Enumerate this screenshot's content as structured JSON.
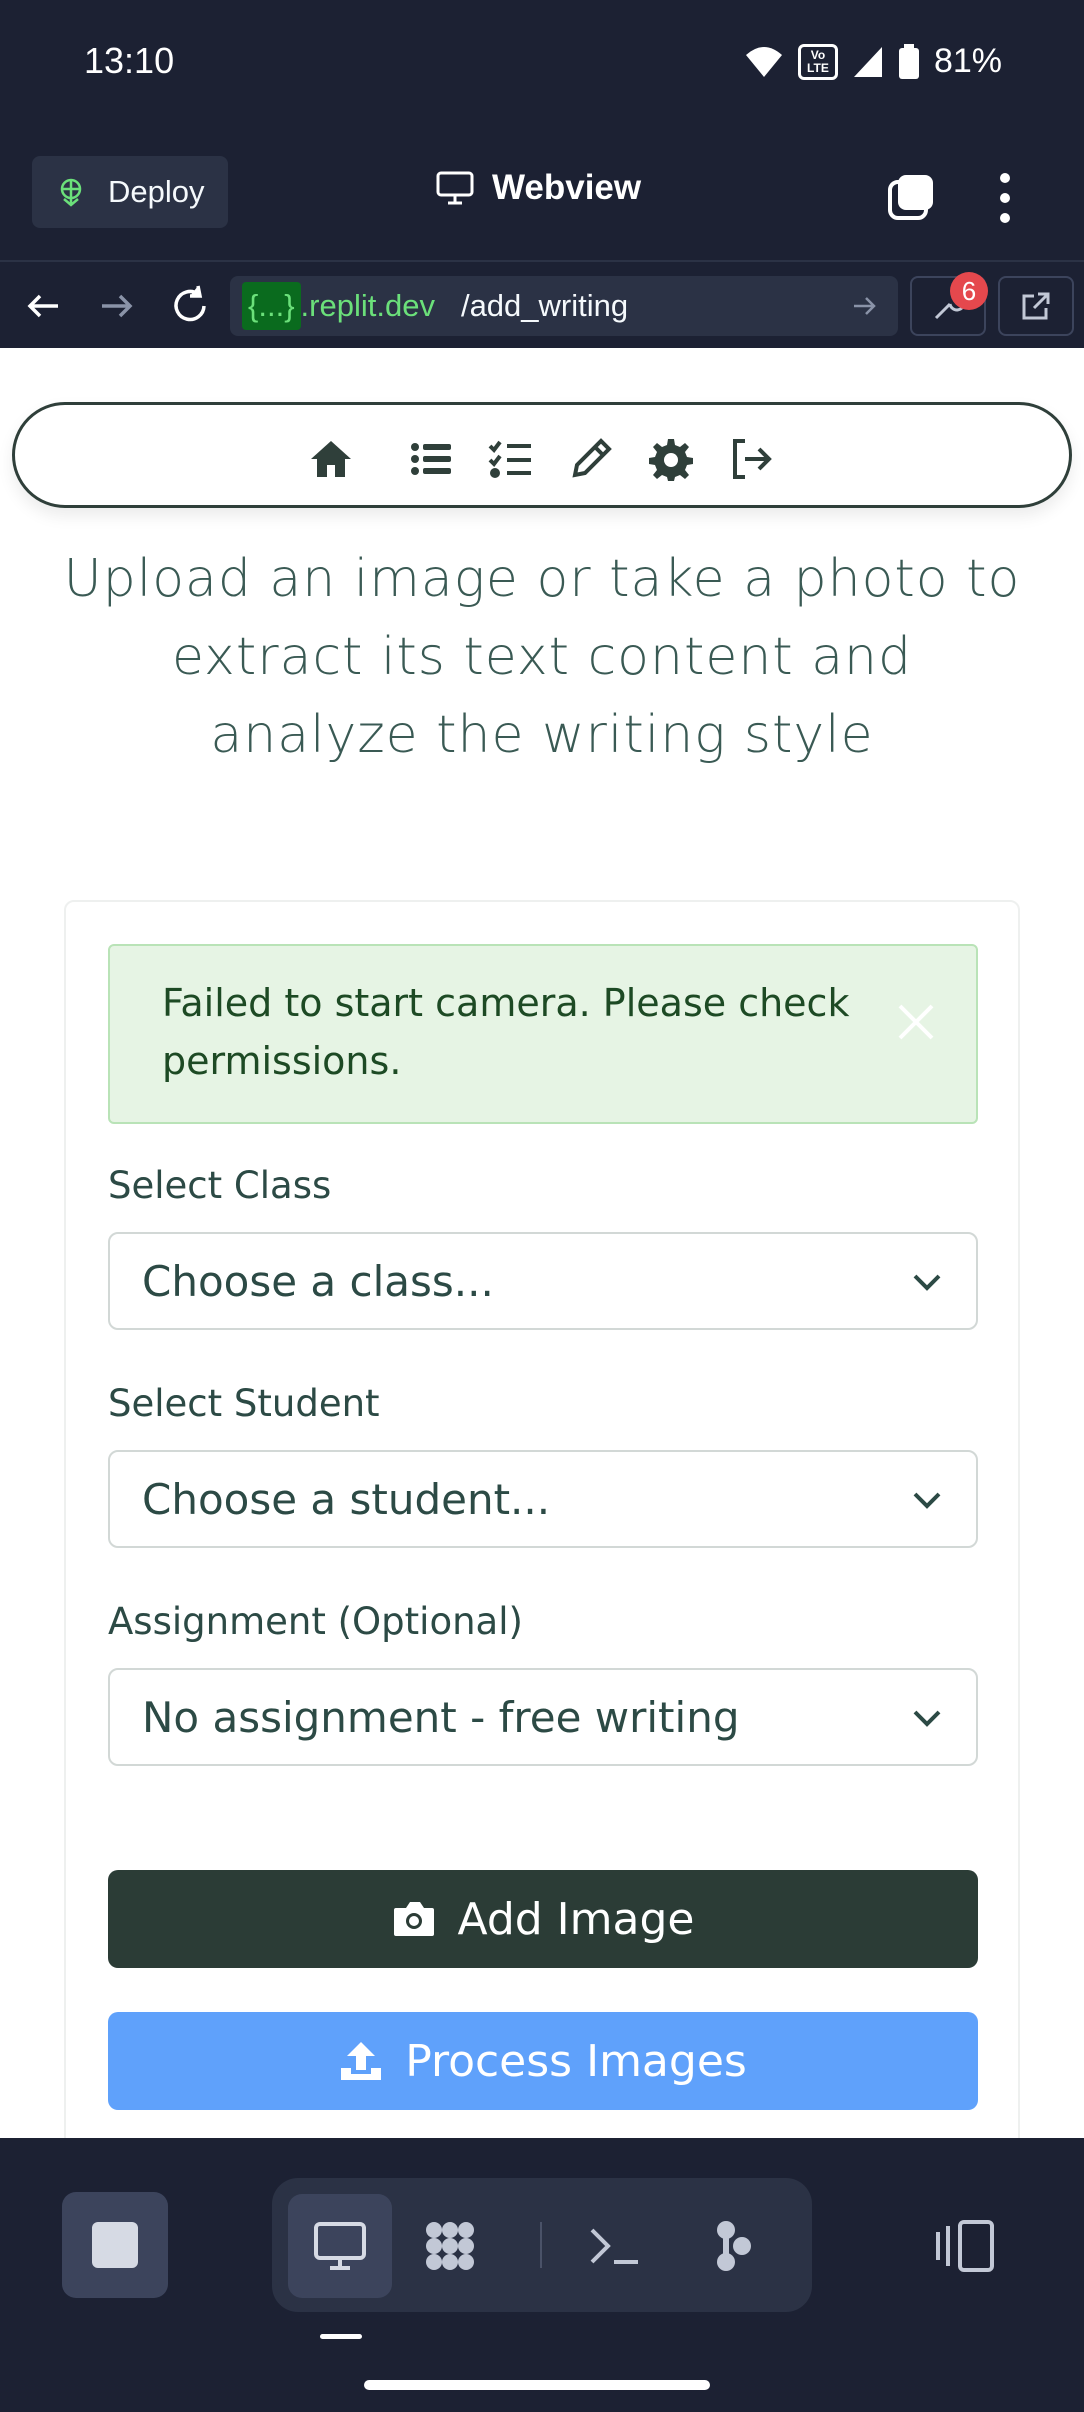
{
  "status_bar": {
    "time": "13:10",
    "network": "VoLTE",
    "battery": "81%"
  },
  "topbar": {
    "deploy_label": "Deploy",
    "title": "Webview"
  },
  "urlbar": {
    "host_prefix": "{...}",
    "host": ".replit.dev",
    "path": "/add_writing",
    "devtools_badge": "6"
  },
  "app_nav": {
    "items": [
      "home-icon",
      "list-icon",
      "checklist-icon",
      "pencil-icon",
      "gear-icon",
      "logout-icon"
    ]
  },
  "page": {
    "heading": "Upload an image or take a photo to extract its text content and analyze the writing style"
  },
  "alert": {
    "message": "Failed to start camera. Please check permissions."
  },
  "form": {
    "class_label": "Select Class",
    "class_value": "Choose a class...",
    "student_label": "Select Student",
    "student_value": "Choose a student...",
    "assignment_label": "Assignment (Optional)",
    "assignment_value": "No assignment - free writing",
    "add_image_label": "Add Image",
    "process_images_label": "Process Images"
  },
  "bottom_toolbar": {
    "tools": [
      "webview-icon",
      "workspace-icon",
      "shell-icon",
      "git-icon"
    ]
  },
  "colors": {
    "primary_dark": "#2b3c36",
    "primary_blue": "#5fa1fb",
    "alert_bg": "#e6f4e4",
    "ide_bg": "#1c2133"
  }
}
